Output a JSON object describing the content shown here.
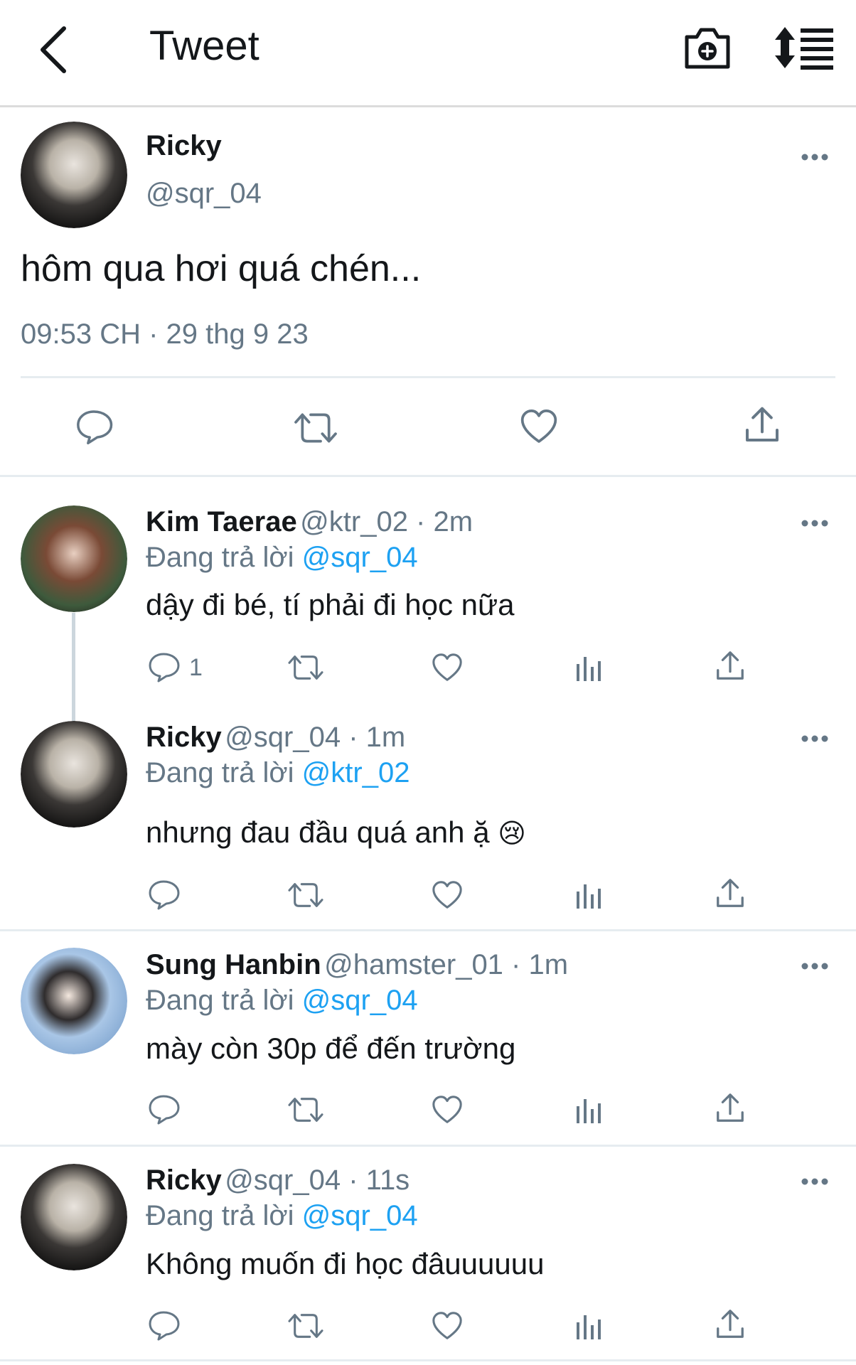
{
  "header": {
    "title": "Tweet"
  },
  "main_tweet": {
    "name": "Ricky",
    "handle": "@sqr_04",
    "text": "hôm qua hơi quá chén...",
    "timestamp": "09:53 CH · 29 thg 9 23"
  },
  "replies": [
    {
      "name": "Kim Taerae",
      "handle": "@ktr_02 · 2m",
      "replying_prefix": "Đang trả lời",
      "replying_to": "@sqr_04",
      "text": "dậy đi bé, tí phải đi học nữa",
      "reply_count": "1"
    },
    {
      "name": "Ricky",
      "handle": "@sqr_04 · 1m",
      "replying_prefix": "Đang trả lời",
      "replying_to": "@ktr_02",
      "text": "nhưng đau đầu quá anh ặ",
      "emoji": "😢"
    },
    {
      "name": "Sung Hanbin",
      "handle": "@hamster_01 · 1m",
      "replying_prefix": "Đang trả lời",
      "replying_to": "@sqr_04",
      "text": "mày còn 30p để đến trường"
    },
    {
      "name": "Ricky",
      "handle": "@sqr_04 · 11s",
      "replying_prefix": "Đang trả lời",
      "replying_to": "@sqr_04",
      "text": "Không muốn đi học đâuuuuuu"
    }
  ],
  "colors": {
    "link": "#1da1f2",
    "muted": "#657786",
    "text": "#14171a"
  },
  "icons": [
    "back-icon",
    "camera-icon",
    "sort-icon",
    "more-icon",
    "reply-icon",
    "retweet-icon",
    "like-icon",
    "analytics-icon",
    "share-icon"
  ]
}
